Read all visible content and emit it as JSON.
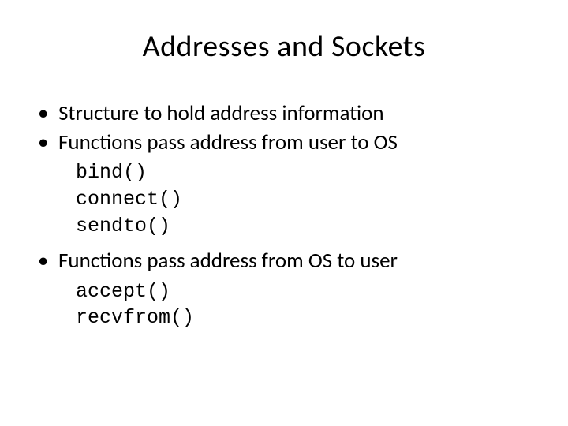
{
  "slide": {
    "title": "Addresses and Sockets",
    "bullets": {
      "b1": "Structure to hold address information",
      "b2": "Functions pass address from user to OS",
      "code2": {
        "l1": "bind()",
        "l2": "connect()",
        "l3": "sendto()"
      },
      "b3": "Functions pass address from OS to user",
      "code3": {
        "l1": "accept()",
        "l2": "recvfrom()"
      }
    }
  }
}
